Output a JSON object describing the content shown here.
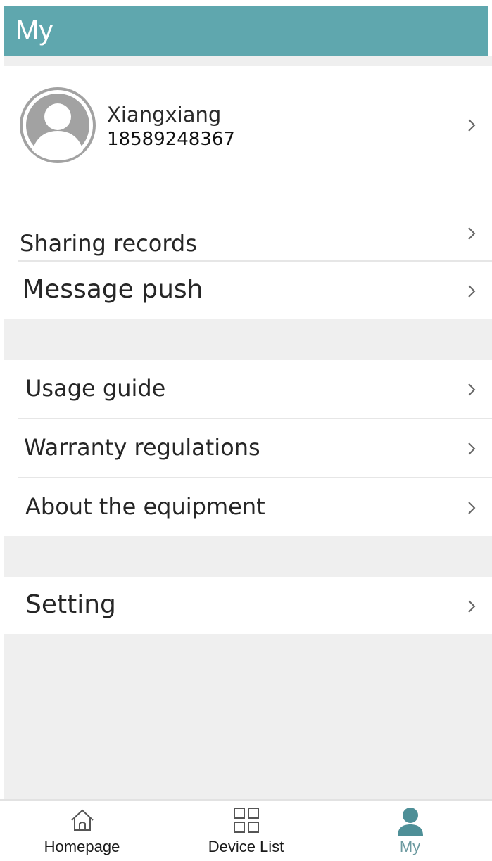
{
  "header": {
    "title": "My"
  },
  "profile": {
    "name": "Xiangxiang",
    "phone": "18589248367"
  },
  "groups": [
    {
      "items": [
        {
          "label": "Sharing records"
        },
        {
          "label": "Message push"
        }
      ]
    },
    {
      "items": [
        {
          "label": "Usage guide"
        },
        {
          "label": "Warranty regulations"
        },
        {
          "label": "About the equipment"
        }
      ]
    },
    {
      "items": [
        {
          "label": "Setting"
        }
      ]
    }
  ],
  "tabbar": {
    "tabs": [
      {
        "label": "Homepage",
        "icon": "home-icon",
        "active": false
      },
      {
        "label": "Device List",
        "icon": "grid-icon",
        "active": false
      },
      {
        "label": "My",
        "icon": "person-icon",
        "active": true
      }
    ]
  },
  "colors": {
    "header": "#5fa7ae",
    "active_tab": "#6d9aa0",
    "background": "#efefef"
  }
}
